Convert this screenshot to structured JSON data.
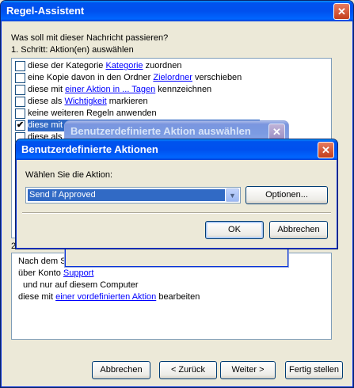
{
  "main_window": {
    "title": "Regel-Assistent",
    "question": "Was soll mit dieser Nachricht passieren?",
    "step1": "1. Schritt: Aktion(en) auswählen",
    "actions": [
      {
        "pre": "diese der Kategorie ",
        "link": "Kategorie",
        "post": " zuordnen",
        "checked": false
      },
      {
        "pre": "eine Kopie davon in den Ordner ",
        "link": "Zielordner",
        "post": " verschieben",
        "checked": false
      },
      {
        "pre": "diese mit ",
        "link": "einer Aktion in ... Tagen",
        "post": " kennzeichnen",
        "checked": false
      },
      {
        "pre": "diese als ",
        "link": "Wichtigkeit",
        "post": " markieren",
        "checked": false
      },
      {
        "pre": "keine weiteren Regeln anwenden",
        "link": "",
        "post": "",
        "checked": false
      },
      {
        "pre": "diese mit e",
        "link": "",
        "post": "",
        "checked": true
      },
      {
        "pre": "diese als W",
        "link": "",
        "post": "",
        "checked": false
      }
    ],
    "step2_partial": "2",
    "description": {
      "line1": "Nach dem Se",
      "line2_pre": "über Konto ",
      "line2_link": "Support",
      "line3": "und nur auf diesem Computer",
      "line4_pre": "diese mit ",
      "line4_link": "einer vordefinierten Aktion",
      "line4_post": " bearbeiten"
    },
    "buttons": {
      "cancel": "Abbrechen",
      "back": "< Zurück",
      "next": "Weiter >",
      "finish": "Fertig stellen"
    }
  },
  "middle_dialog": {
    "title": "Benutzerdefinierte Aktion auswählen"
  },
  "front_dialog": {
    "title": "Benutzerdefinierte Aktionen",
    "prompt": "Wählen Sie die Aktion:",
    "selected_action": "Send if Approved",
    "options_button": "Optionen...",
    "ok_button": "OK",
    "cancel_button": "Abbrechen"
  },
  "close_glyph": "✕",
  "check_glyph": "✔",
  "dropdown_glyph": "▼"
}
